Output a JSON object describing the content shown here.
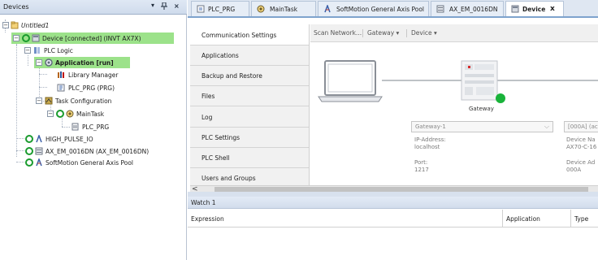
{
  "devices_panel": {
    "title": "Devices",
    "controls": {
      "dropdown": "▾",
      "pin": "ᵠ",
      "close": "×"
    },
    "tree": [
      {
        "label": "Untitled1",
        "icon": "project-icon"
      },
      {
        "label": "Device [connected] (INVT AX7X)",
        "icon": "device-icon",
        "highlighted": true
      },
      {
        "label": "PLC Logic",
        "icon": "plc-logic-icon"
      },
      {
        "label": "Application [run]",
        "icon": "application-icon",
        "highlighted": true
      },
      {
        "label": "Library Manager",
        "icon": "library-icon"
      },
      {
        "label": "PLC_PRG (PRG)",
        "icon": "program-icon"
      },
      {
        "label": "Task Configuration",
        "icon": "task-config-icon"
      },
      {
        "label": "MainTask",
        "icon": "task-icon"
      },
      {
        "label": "PLC_PRG",
        "icon": "program-call-icon"
      },
      {
        "label": "HIGH_PULSE_IO",
        "icon": "axis-icon"
      },
      {
        "label": "AX_EM_0016DN (AX_EM_0016DN)",
        "icon": "io-module-icon"
      },
      {
        "label": "SoftMotion General Axis Pool",
        "icon": "axis-pool-icon"
      }
    ]
  },
  "tabs": [
    {
      "label": "PLC_PRG",
      "icon": "program-icon"
    },
    {
      "label": "MainTask",
      "icon": "task-icon"
    },
    {
      "label": "SoftMotion General Axis Pool",
      "icon": "axis-pool-icon"
    },
    {
      "label": "AX_EM_0016DN",
      "icon": "io-module-icon"
    },
    {
      "label": "Device",
      "icon": "device-icon",
      "active": true,
      "close": "x"
    }
  ],
  "device_editor": {
    "nav": [
      {
        "label": "Communication Settings",
        "active": true
      },
      {
        "label": "Applications"
      },
      {
        "label": "Backup and Restore"
      },
      {
        "label": "Files"
      },
      {
        "label": "Log"
      },
      {
        "label": "PLC Settings"
      },
      {
        "label": "PLC Shell"
      },
      {
        "label": "Users and Groups"
      }
    ],
    "scroll_left": "<",
    "toolbar": {
      "scan_network": "Scan Network...",
      "gateway": "Gateway",
      "device": "Device",
      "dropdown_arrow": "▾"
    },
    "gateway": {
      "name": "Gateway",
      "status_color": "#19b33a",
      "selected": "Gateway-1",
      "ip_label": "IP-Address:",
      "ip_value": "localhost",
      "port_label": "Port:",
      "port_value": "1217"
    },
    "device": {
      "selected": "[000A] (ac",
      "name_label": "Device Na",
      "name_value": "AX70-C-16",
      "address_label": "Device Ad",
      "address_value": "000A"
    }
  },
  "watch": {
    "title": "Watch 1",
    "columns": [
      "Expression",
      "Application",
      "Type"
    ]
  },
  "colors": {
    "tree_highlight": "#9ce28a",
    "panel_header": "#d6e1ef",
    "nav_background": "#f1f1f1"
  }
}
